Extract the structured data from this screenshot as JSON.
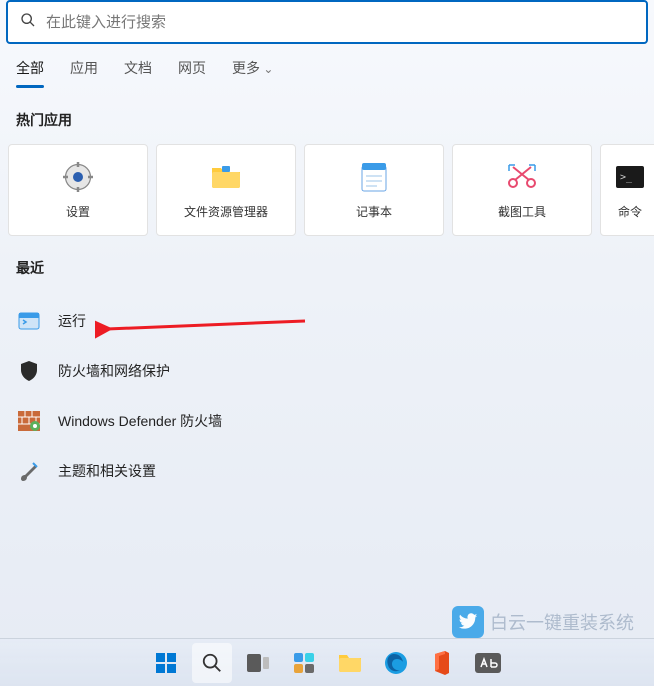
{
  "search": {
    "placeholder": "在此键入进行搜索"
  },
  "tabs": {
    "all": "全部",
    "apps": "应用",
    "docs": "文档",
    "web": "网页",
    "more": "更多"
  },
  "sections": {
    "hot_apps": "热门应用",
    "recent": "最近"
  },
  "hot_apps": [
    {
      "label": "设置",
      "icon": "gear"
    },
    {
      "label": "文件资源管理器",
      "icon": "folder"
    },
    {
      "label": "记事本",
      "icon": "notepad"
    },
    {
      "label": "截图工具",
      "icon": "snip"
    },
    {
      "label": "命令",
      "icon": "cmd"
    }
  ],
  "recent": [
    {
      "label": "运行",
      "icon": "run"
    },
    {
      "label": "防火墙和网络保护",
      "icon": "shield"
    },
    {
      "label": "Windows Defender 防火墙",
      "icon": "wall"
    },
    {
      "label": "主题和相关设置",
      "icon": "brush"
    }
  ],
  "watermark": "白云一键重装系统",
  "colors": {
    "accent": "#0067c0",
    "arrow": "#ed1c24"
  }
}
